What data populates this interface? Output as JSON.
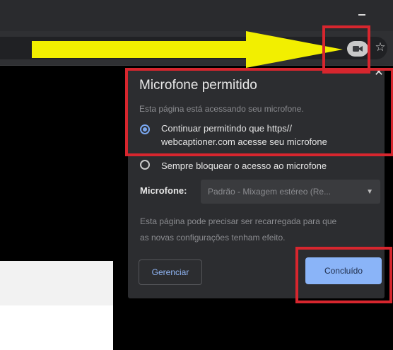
{
  "window": {
    "minimize_icon": "minimize-icon"
  },
  "toolbar": {
    "camera_icon": "camera-icon",
    "star_icon": "bookmark-star-icon"
  },
  "popup": {
    "title": "Microfone permitido",
    "description": "Esta página está acessando seu microfone.",
    "options": [
      {
        "label_line1": "Continuar permitindo que https//",
        "label_line2": "webcaptioner.com acesse seu microfone",
        "selected": true
      },
      {
        "label": "Sempre bloquear o acesso ao microfone",
        "selected": false
      }
    ],
    "microphone_label": "Microfone:",
    "microphone_value": "Padrão - Mixagem estéreo (Re...",
    "reload_note_line1": "Esta página pode precisar ser recarregada para que",
    "reload_note_line2": "as novas configurações tenham efeito.",
    "manage_button": "Gerenciar",
    "done_button": "Concluído",
    "close_icon": "close-icon"
  },
  "colors": {
    "accent": "#8ab4f8",
    "annotation_red": "#d7262e",
    "annotation_arrow": "#f2ef00",
    "popup_bg": "#2c2d30"
  }
}
